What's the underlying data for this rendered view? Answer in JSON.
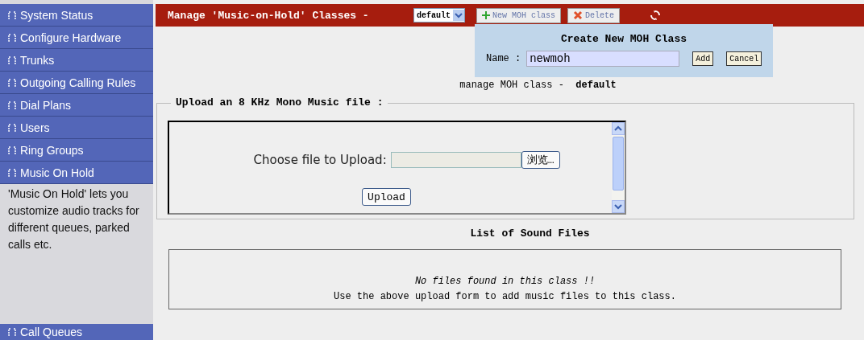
{
  "sidebar": {
    "items": [
      {
        "label": "System Status"
      },
      {
        "label": "Configure Hardware"
      },
      {
        "label": "Trunks"
      },
      {
        "label": "Outgoing Calling Rules"
      },
      {
        "label": "Dial Plans"
      },
      {
        "label": "Users"
      },
      {
        "label": "Ring Groups"
      },
      {
        "label": "Music On Hold"
      }
    ],
    "description": "'Music On Hold' lets you customize audio tracks for different queues, parked calls etc.",
    "bottom_item": {
      "label": "Call Queues"
    }
  },
  "header": {
    "title": "Manage 'Music-on-Hold' Classes -",
    "class_select": "default",
    "new_button": "New MOH class",
    "delete_button": "Delete"
  },
  "popup": {
    "title": "Create New MOH Class",
    "name_label": "Name :",
    "name_value": "newmoh",
    "add_button": "Add",
    "cancel_button": "Cancel"
  },
  "current_class": {
    "label": "manage MOH class -",
    "value": "default"
  },
  "upload": {
    "legend": "Upload an 8 KHz Mono Music file :",
    "file_label": "Choose file to Upload:",
    "browse_button": "浏览…",
    "upload_button": "Upload"
  },
  "sound_files": {
    "title": "List of Sound Files",
    "empty_message": "No files found in this class !!",
    "hint": "Use the above upload form to add music files to this class."
  }
}
